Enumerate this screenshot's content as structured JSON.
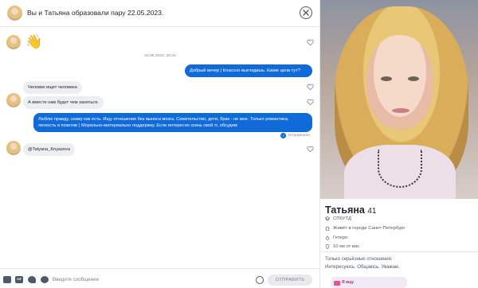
{
  "header": {
    "title": "Вы и Татьяна образовали пару 22.05.2023."
  },
  "messages": {
    "wave": "👋",
    "timestamp": "22.05.2023, 20:44",
    "out_1": "Добрый вечер ) Классно выглядишь. Какие цели тут?",
    "in_1": "Человек ищет человека",
    "in_2": "А вместе нам будет чем заняться.",
    "out_2": "Люблю правду, скажу как есть. Ищу отношения без выноса мозга. Сожительство, дети, брак - не мое. Только романтика, легкость и позитив ) Морально-материально поддержку. Если интересно скинь свой тг, обсудим",
    "status": "Отправлено",
    "in_3": "@Tatyana_Knyazeva"
  },
  "composer": {
    "placeholder": "Введите сообщение",
    "gif_label": "GIF",
    "send_label": "ОТПРАВИТЬ"
  },
  "profile": {
    "name": "Татьяна",
    "age": "41",
    "education": "СПбУТД",
    "city": "Живёт в городе Санкт-Петербург",
    "orientation": "Гетеро",
    "distance": "10 км от вас",
    "bio": "Только серьёзные отношения.\nИнтересуюсь. Общаюсь. Уважаю.",
    "looking_label": "Я ищу"
  },
  "colors": {
    "accent": "#106bd8",
    "incoming_bubble": "#eceef1",
    "text": "#21262e",
    "muted": "#7c8591"
  },
  "icons": [
    "close-icon",
    "heart-icon",
    "image-icon",
    "gif-icon",
    "sticker-icon",
    "music-icon",
    "emoji-icon",
    "education-icon",
    "home-icon",
    "gender-icon",
    "location-icon"
  ]
}
